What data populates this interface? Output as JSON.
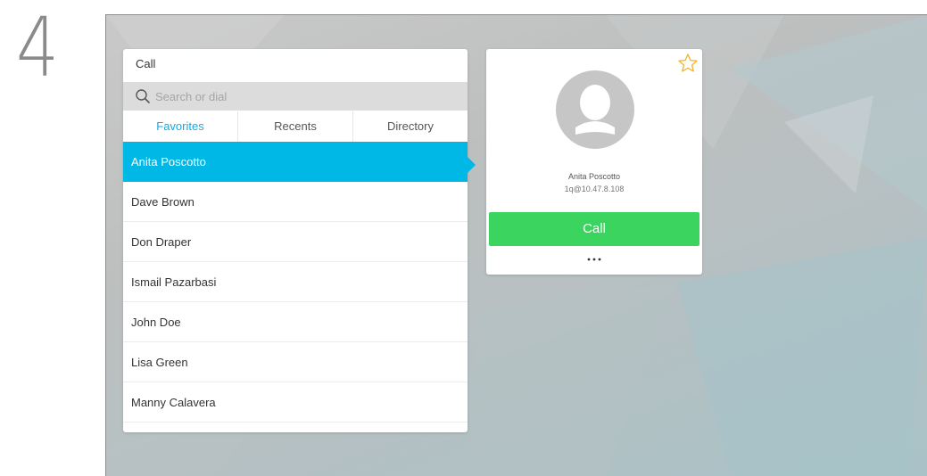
{
  "step": {
    "number": "4"
  },
  "call_panel": {
    "title": "Call",
    "search": {
      "placeholder": "Search or dial",
      "value": ""
    },
    "tabs": [
      {
        "label": "Favorites",
        "active": true
      },
      {
        "label": "Recents",
        "active": false
      },
      {
        "label": "Directory",
        "active": false
      }
    ],
    "contacts": [
      {
        "name": "Anita Poscotto",
        "selected": true
      },
      {
        "name": "Dave Brown",
        "selected": false
      },
      {
        "name": "Don Draper",
        "selected": false
      },
      {
        "name": "Ismail Pazarbasi",
        "selected": false
      },
      {
        "name": "John Doe",
        "selected": false
      },
      {
        "name": "Lisa Green",
        "selected": false
      },
      {
        "name": "Manny Calavera",
        "selected": false
      }
    ]
  },
  "contact_card": {
    "name": "Anita Poscotto",
    "address": "1q@10.47.8.108",
    "call_button_label": "Call",
    "favorite_icon": "star-outline-icon",
    "more_icon": "more-options-icon",
    "avatar_icon": "person-silhouette-icon"
  },
  "colors": {
    "selected_row": "#00b8e6",
    "active_tab": "#1aa7de",
    "call_button": "#3bd45f",
    "favorite_star": "#f0b429"
  }
}
